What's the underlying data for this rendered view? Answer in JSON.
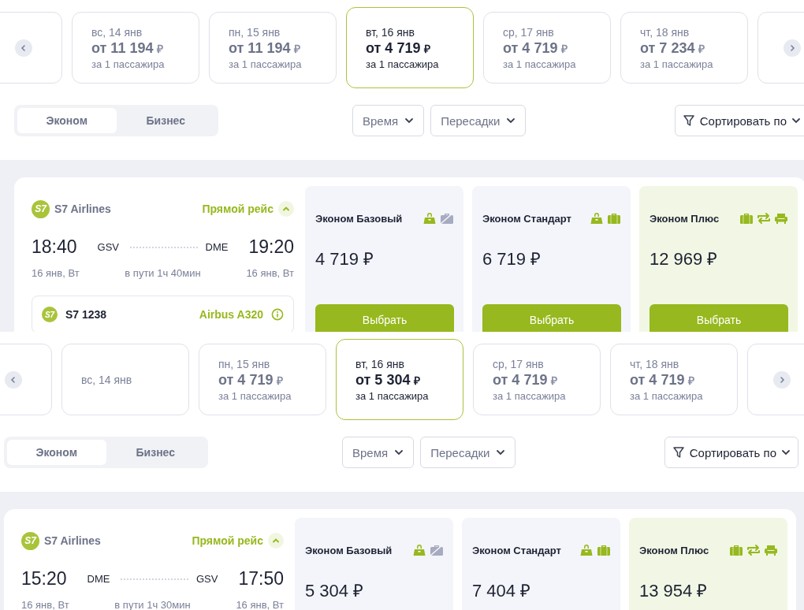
{
  "panels": [
    {
      "dates": [
        {
          "date": "вс, 14 янв",
          "price": "от 11 194",
          "currency": "₽",
          "note": "за 1 пассажира",
          "selected": false
        },
        {
          "date": "пн, 15 янв",
          "price": "от 11 194",
          "currency": "₽",
          "note": "за 1 пассажира",
          "selected": false
        },
        {
          "date": "вт, 16 янв",
          "price": "от 4 719",
          "currency": "₽",
          "note": "за 1 пассажира",
          "selected": true
        },
        {
          "date": "ср, 17 янв",
          "price": "от 4 719",
          "currency": "₽",
          "note": "за 1 пассажира",
          "selected": false
        },
        {
          "date": "чт, 18 янв",
          "price": "от 7 234",
          "currency": "₽",
          "note": "за 1 пассажира",
          "selected": false
        }
      ],
      "classes": [
        {
          "label": "Эконом",
          "selected": true
        },
        {
          "label": "Бизнес",
          "selected": false
        }
      ],
      "filters": [
        "Время",
        "Пересадки"
      ],
      "sort": "Сортировать по",
      "flight": {
        "logo": "S7",
        "airline": "S7 Airlines",
        "route_type": "Прямой рейс",
        "expanded": true,
        "departure": {
          "time": "18:40",
          "airport": "GSV",
          "date": "16 янв, Вт"
        },
        "arrival": {
          "time": "19:20",
          "airport": "DME",
          "date": "16 янв, Вт"
        },
        "duration": "в пути 1ч 40мин",
        "number_logo": "S7",
        "flight_number": "S7 1238",
        "aircraft": "Airbus A320",
        "fares": [
          {
            "name": "Эконом Базовый",
            "price": "4 719 ₽",
            "highlighted": false,
            "icons": [
              {
                "kind": "bag",
                "included": true
              },
              {
                "kind": "suitcase",
                "included": false
              }
            ],
            "button": "Выбрать"
          },
          {
            "name": "Эконом Стандарт",
            "price": "6 719 ₽",
            "highlighted": false,
            "icons": [
              {
                "kind": "bag",
                "included": true
              },
              {
                "kind": "suitcase",
                "included": true
              }
            ],
            "button": "Выбрать"
          },
          {
            "name": "Эконом Плюс",
            "price": "12 969 ₽",
            "highlighted": true,
            "icons": [
              {
                "kind": "suitcase",
                "included": true
              },
              {
                "kind": "exchange",
                "included": true
              },
              {
                "kind": "seat",
                "included": true
              }
            ],
            "button": "Выбрать"
          }
        ]
      }
    },
    {
      "dates": [
        {
          "date": "вс, 14 янв",
          "selected": false
        },
        {
          "date": "пн, 15 янв",
          "price": "от 4 719",
          "currency": "₽",
          "note": "за 1 пассажира",
          "selected": false
        },
        {
          "date": "вт, 16 янв",
          "price": "от 5 304",
          "currency": "₽",
          "note": "за 1 пассажира",
          "selected": true
        },
        {
          "date": "ср, 17 янв",
          "price": "от 4 719",
          "currency": "₽",
          "note": "за 1 пассажира",
          "selected": false
        },
        {
          "date": "чт, 18 янв",
          "price": "от 4 719",
          "currency": "₽",
          "note": "за 1 пассажира",
          "selected": false
        }
      ],
      "classes": [
        {
          "label": "Эконом",
          "selected": true
        },
        {
          "label": "Бизнес",
          "selected": false
        }
      ],
      "filters": [
        "Время",
        "Пересадки"
      ],
      "sort": "Сортировать по",
      "flight": {
        "logo": "S7",
        "airline": "S7 Airlines",
        "route_type": "Прямой рейс",
        "expanded": true,
        "departure": {
          "time": "15:20",
          "airport": "DME",
          "date": "16 янв, Вт"
        },
        "arrival": {
          "time": "17:50",
          "airport": "GSV",
          "date": "16 янв, Вт"
        },
        "duration": "в пути 1ч 30мин",
        "fares": [
          {
            "name": "Эконом Базовый",
            "price": "5 304 ₽",
            "highlighted": false,
            "icons": [
              {
                "kind": "bag",
                "included": true
              },
              {
                "kind": "suitcase",
                "included": false
              }
            ]
          },
          {
            "name": "Эконом Стандарт",
            "price": "7 404 ₽",
            "highlighted": false,
            "icons": [
              {
                "kind": "bag",
                "included": true
              },
              {
                "kind": "suitcase",
                "included": true
              }
            ]
          },
          {
            "name": "Эконом Плюс",
            "price": "13 954 ₽",
            "highlighted": true,
            "icons": [
              {
                "kind": "suitcase",
                "included": true
              },
              {
                "kind": "exchange",
                "included": true
              },
              {
                "kind": "seat",
                "included": true
              }
            ]
          }
        ]
      }
    }
  ]
}
